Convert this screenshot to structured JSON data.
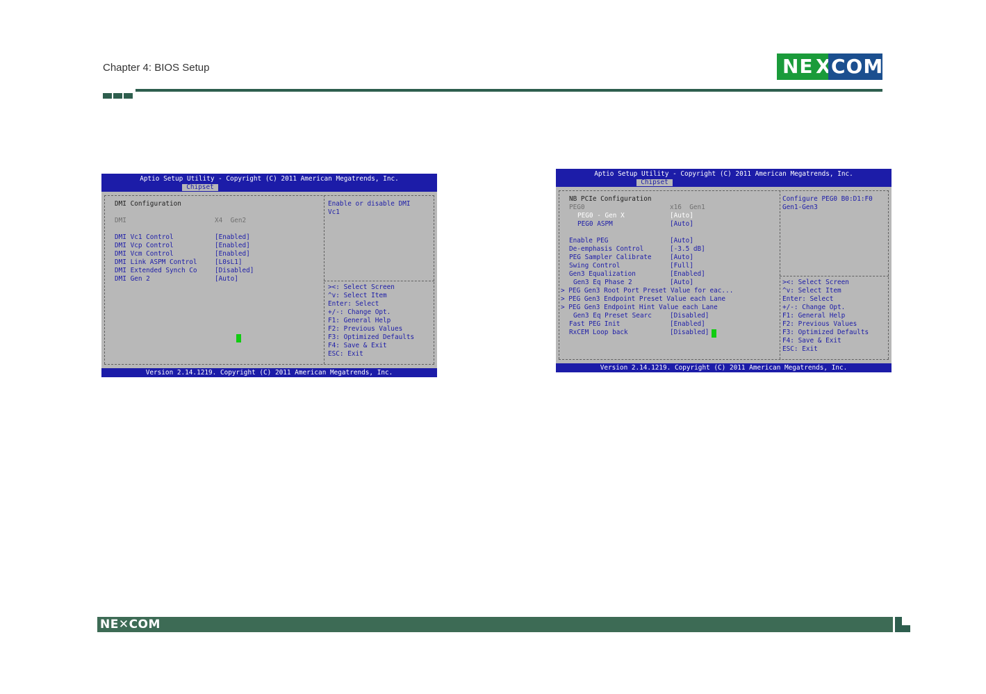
{
  "header": {
    "chapter_title": "Chapter 4: BIOS Setup",
    "logo_ne": "NE",
    "logo_x": "X",
    "logo_com": "COM"
  },
  "footer": {
    "logo_text": "NE✕COM"
  },
  "colors": {
    "bios_blue": "#1c1ca8",
    "bios_gray": "#b8b8b8",
    "header_green": "#2e5e4e",
    "logo_green": "#1a9b3a",
    "logo_blue": "#1b4f8f"
  },
  "left_screen": {
    "title": "Aptio Setup Utility - Copyright (C) 2011 American Megatrends, Inc.",
    "tab": "Chipset",
    "footer": "Version 2.14.1219. Copyright (C) 2011 American Megatrends, Inc.",
    "section": "DMI Configuration",
    "info_label": "DMI",
    "info_value": "X4  Gen2",
    "items": [
      {
        "label": "DMI Vc1 Control",
        "value": "[Enabled]"
      },
      {
        "label": "DMI Vcp Control",
        "value": "[Enabled]"
      },
      {
        "label": "DMI Vcm Control",
        "value": "[Enabled]"
      },
      {
        "label": "DMI Link ASPM Control",
        "value": "[L0sL1]"
      },
      {
        "label": "DMI Extended Synch Co",
        "value": "[Disabled]"
      },
      {
        "label": "DMI Gen 2",
        "value": "[Auto]"
      }
    ],
    "help": [
      "Enable or disable DMI",
      "Vc1"
    ],
    "keys": [
      "><: Select Screen",
      "^v: Select Item",
      "Enter: Select",
      "+/-: Change Opt.",
      "F1: General Help",
      "F2: Previous Values",
      "F3: Optimized Defaults",
      "F4: Save & Exit",
      "ESC: Exit"
    ]
  },
  "right_screen": {
    "title": "Aptio Setup Utility - Copyright (C) 2011 American Megatrends, Inc.",
    "tab": "Chipset",
    "footer": "Version 2.14.1219. Copyright (C) 2011 American Megatrends, Inc.",
    "section": "NB PCIe Configuration",
    "peg_label": "PEG0",
    "peg_value": "x16  Gen1",
    "sub_items": [
      {
        "label": "PEG0 - Gen X",
        "value": "[Auto]"
      },
      {
        "label": "PEG0 ASPM",
        "value": "[Auto]"
      }
    ],
    "items": [
      {
        "label": "Enable PEG",
        "value": "[Auto]"
      },
      {
        "label": "De-emphasis Control",
        "value": "[-3.5 dB]"
      },
      {
        "label": "PEG Sampler Calibrate",
        "value": "[Auto]"
      },
      {
        "label": "Swing Control",
        "value": "[Full]"
      },
      {
        "label": "Gen3 Equalization",
        "value": "[Enabled]"
      }
    ],
    "phase_label": "Gen3 Eq Phase 2",
    "phase_value": "[Auto]",
    "submenus": [
      "> PEG Gen3 Root Port Preset Value for eac...",
      "> PEG Gen3 Endpoint Preset Value each Lane",
      "> PEG Gen3 Endpoint Hint Value each Lane"
    ],
    "tail_items": [
      {
        "label": "Gen3 Eq Preset Searc",
        "value": "[Disabled]"
      },
      {
        "label": "Fast PEG Init",
        "value": "[Enabled]"
      },
      {
        "label": "RxCEM Loop back",
        "value": "[Disabled]"
      }
    ],
    "help": [
      "Configure PEG0 B0:D1:F0",
      "Gen1-Gen3"
    ],
    "keys": [
      "><: Select Screen",
      "^v: Select Item",
      "Enter: Select",
      "+/-: Change Opt.",
      "F1: General Help",
      "F2: Previous Values",
      "F3: Optimized Defaults",
      "F4: Save & Exit",
      "ESC: Exit"
    ]
  }
}
